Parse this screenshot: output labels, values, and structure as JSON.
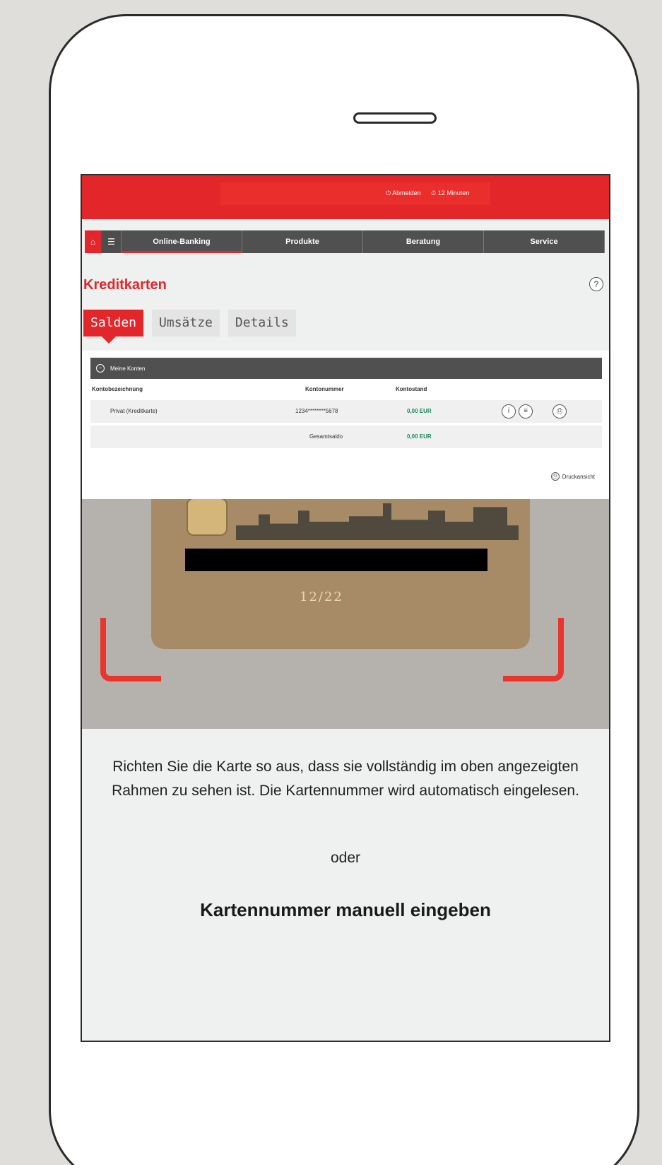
{
  "session": {
    "logout_label": "Abmelden",
    "timer_label": "12 Minuten"
  },
  "nav": {
    "items": [
      {
        "label": "Online-Banking",
        "active": true
      },
      {
        "label": "Produkte"
      },
      {
        "label": "Beratung"
      },
      {
        "label": "Service"
      }
    ]
  },
  "page": {
    "title": "Kreditkarten"
  },
  "tabs": [
    {
      "label": "Salden"
    },
    {
      "label": "Umsätze"
    },
    {
      "label": "Details"
    }
  ],
  "accounts": {
    "section_title": "Meine Konten",
    "columns": [
      "Kontobezeichnung",
      "Kontonummer",
      "Kontostand"
    ],
    "rows": [
      {
        "name": "Privat (Kreditkarte)",
        "number": "1234********5678",
        "balance": "0,00 EUR"
      }
    ],
    "total_label": "Gesamtsaldo",
    "total_value": "0,00 EUR",
    "print_label": "Druckansicht"
  },
  "card": {
    "expiry": "12/22"
  },
  "scanner": {
    "instruction": "Richten Sie die Karte so aus, dass sie vollständig im oben angezeigten Rahmen zu sehen ist. Die Kartennummer wird automatisch eingelesen.",
    "or_label": "oder",
    "manual_label": "Kartennummer manuell eingeben"
  },
  "colors": {
    "brand_red": "#e3262a",
    "nav_gray": "#505050",
    "positive_green": "#1a8c5b"
  },
  "icons": [
    "home-icon",
    "menu-icon",
    "help-icon",
    "info-icon",
    "list-icon",
    "print-icon",
    "collapse-icon"
  ]
}
